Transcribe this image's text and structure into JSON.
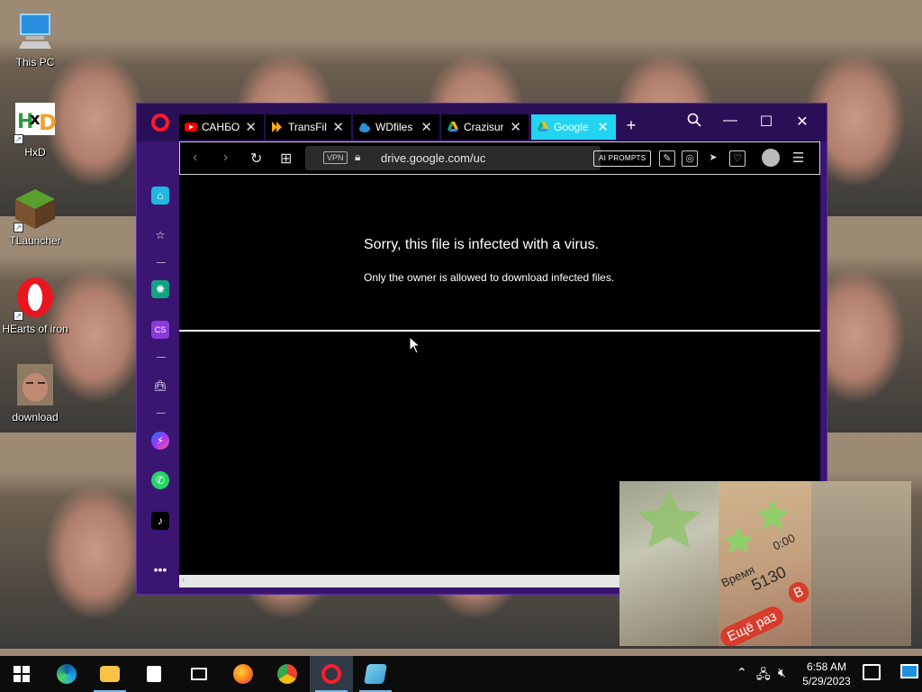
{
  "desktop": {
    "icons": [
      {
        "label": "This PC",
        "icon": "computer-icon"
      },
      {
        "label": "HxD",
        "icon": "hxd-icon"
      },
      {
        "label": "TLauncher",
        "icon": "minecraft-block-icon"
      },
      {
        "label": "HEarts of iron",
        "icon": "opera-icon"
      },
      {
        "label": "download",
        "icon": "photo-thumbnail-icon"
      }
    ]
  },
  "browser": {
    "tabs": [
      {
        "title": "САНБО",
        "favicon": "youtube-icon",
        "color": "#ff0000"
      },
      {
        "title": "TransFil",
        "favicon": "transfile-icon",
        "color": "#f5a623"
      },
      {
        "title": "WDfiles",
        "favicon": "cloud-icon",
        "color": "#2a8fd8"
      },
      {
        "title": "Crazisur",
        "favicon": "google-drive-icon",
        "color": "#1fa463"
      },
      {
        "title": "Google",
        "favicon": "google-drive-icon",
        "color": "#1fa463",
        "active": true
      }
    ],
    "new_tab": "+",
    "address": {
      "vpn": "VPN",
      "url": "drive.google.com/uc",
      "ai_prompts": "AI PROMPTS"
    },
    "page": {
      "title": "Sorry, this file is infected with a virus.",
      "subtitle": "Only the owner is allowed to download infected files."
    },
    "sidebar": [
      "home-icon",
      "bookmark-star-icon",
      "chatgpt-icon",
      "cs-icon",
      "shopping-bag-icon",
      "messenger-icon",
      "whatsapp-icon",
      "tiktok-icon",
      "more-icon"
    ],
    "sidebar_cs_label": "CS",
    "accent": "#3b1572",
    "active_tab_color": "#21d4f2"
  },
  "overlay": {
    "text1": "Время",
    "text2": "5130",
    "text3": "0:00",
    "button1": "Ещё раз",
    "button2": "В"
  },
  "taskbar": {
    "apps": [
      "edge-icon",
      "file-explorer-icon",
      "calculator-icon",
      "mail-icon",
      "firefox-icon",
      "chrome-icon",
      "opera-icon",
      "notepad-icon"
    ],
    "time": "6:58 AM",
    "date": "5/29/2023"
  }
}
